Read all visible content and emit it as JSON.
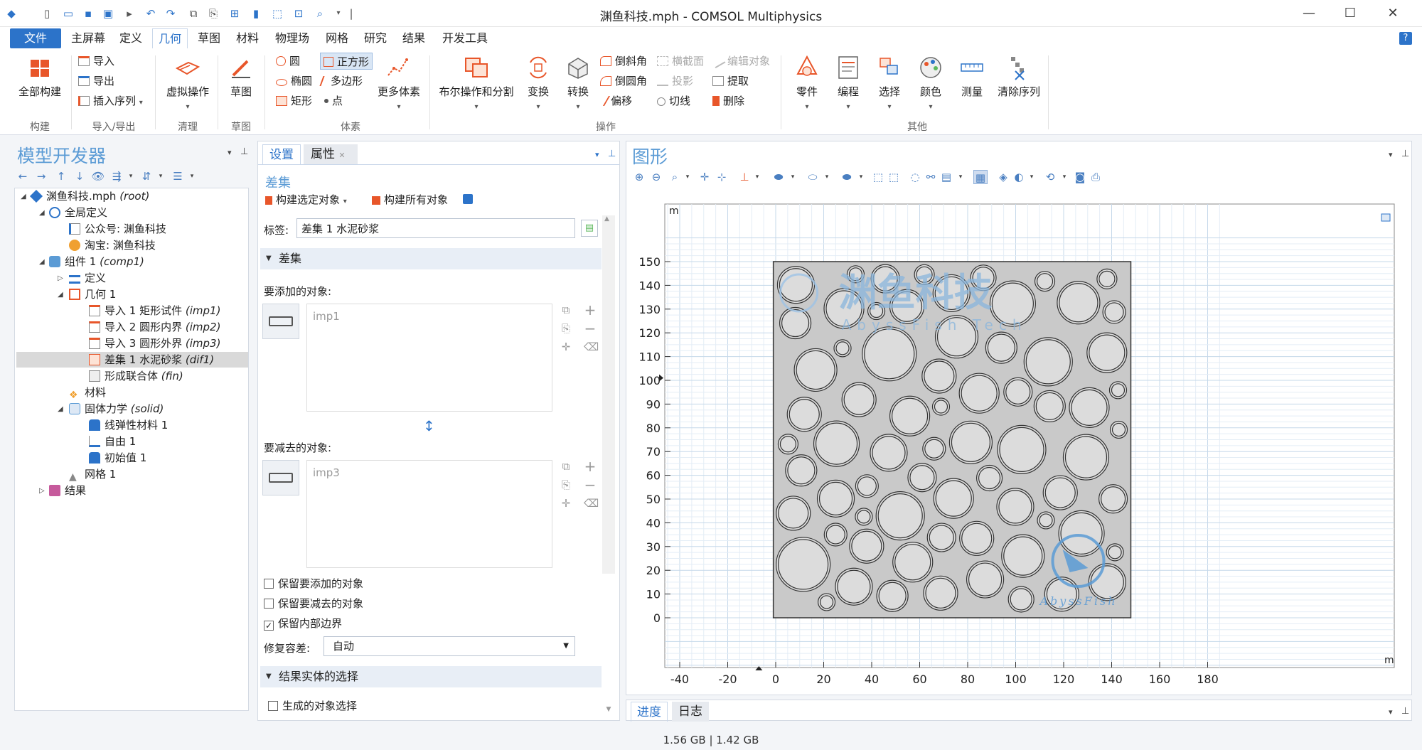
{
  "window": {
    "title": "渊鱼科技.mph - COMSOL Multiphysics",
    "minimize": "—",
    "maximize": "☐",
    "close": "✕"
  },
  "menu": {
    "file": "文件",
    "tabs": [
      "主屏幕",
      "定义",
      "几何",
      "草图",
      "材料",
      "物理场",
      "网格",
      "研究",
      "结果",
      "开发工具"
    ],
    "active_tab": "几何",
    "help": "?"
  },
  "ribbon": {
    "groups": {
      "build": "构建",
      "io": "导入/导出",
      "cleanup": "清理",
      "sketch": "草图",
      "primitives": "体素",
      "operations": "操作",
      "other": "其他"
    },
    "build_all": "全部构建",
    "import": "导入",
    "export": "导出",
    "insert_sequence": "插入序列",
    "virtual_ops": "虚拟操作",
    "sketch": "草图",
    "circle": "圆",
    "square": "正方形",
    "ellipse": "椭圆",
    "polygon": "多边形",
    "rectangle": "矩形",
    "point": "点",
    "more_primitives": "更多体素",
    "boolean_partition": "布尔操作和分割",
    "transforms": "变换",
    "conversions": "转换",
    "chamfer": "倒斜角",
    "fillet": "倒圆角",
    "offset": "偏移",
    "cross_section": "横截面",
    "projection": "投影",
    "tangent": "切线",
    "edit_object": "编辑对象",
    "extract": "提取",
    "delete": "删除",
    "parts": "零件",
    "programming": "编程",
    "selections": "选择",
    "colors": "颜色",
    "measure": "测量",
    "clear_sequence": "清除序列"
  },
  "model_builder": {
    "title": "模型开发器",
    "tree": [
      {
        "label": "渊鱼科技.mph",
        "tag": "(root)"
      },
      {
        "label": "全局定义",
        "tag": ""
      },
      {
        "label": "公众号: 渊鱼科技",
        "tag": ""
      },
      {
        "label": "淘宝: 渊鱼科技",
        "tag": ""
      },
      {
        "label": "组件 1",
        "tag": "(comp1)"
      },
      {
        "label": "定义",
        "tag": ""
      },
      {
        "label": "几何 1",
        "tag": ""
      },
      {
        "label": "导入 1 矩形试件",
        "tag": "(imp1)"
      },
      {
        "label": "导入 2 圆形内界",
        "tag": "(imp2)"
      },
      {
        "label": "导入 3 圆形外界",
        "tag": "(imp3)"
      },
      {
        "label": "差集 1 水泥砂浆",
        "tag": "(dif1)"
      },
      {
        "label": "形成联合体",
        "tag": "(fin)"
      },
      {
        "label": "材料",
        "tag": ""
      },
      {
        "label": "固体力学",
        "tag": "(solid)"
      },
      {
        "label": "线弹性材料 1",
        "tag": ""
      },
      {
        "label": "自由 1",
        "tag": ""
      },
      {
        "label": "初始值 1",
        "tag": ""
      },
      {
        "label": "网格 1",
        "tag": ""
      },
      {
        "label": "结果",
        "tag": ""
      }
    ]
  },
  "settings": {
    "tab_settings": "设置",
    "tab_properties": "属性",
    "node_title": "差集",
    "build_selected": "构建选定对象",
    "build_all": "构建所有对象",
    "label_caption": "标签:",
    "label_value": "差集 1 水泥砂浆",
    "section_difference": "差集",
    "objects_to_add": "要添加的对象:",
    "add_item": "imp1",
    "objects_to_subtract": "要减去的对象:",
    "subtract_item": "imp3",
    "keep_add": "保留要添加的对象",
    "keep_subtract": "保留要减去的对象",
    "keep_interior": "保留内部边界",
    "repair_tolerance": "修复容差:",
    "repair_value": "自动",
    "section_result": "结果实体的选择",
    "resulting_selection": "生成的对象选择"
  },
  "graphics": {
    "title": "图形",
    "unit": "m",
    "x_ticks": [
      "-40",
      "-20",
      "0",
      "20",
      "40",
      "60",
      "80",
      "100",
      "120",
      "140",
      "160",
      "180"
    ],
    "y_ticks": [
      "150",
      "140",
      "130",
      "120",
      "110",
      "100",
      "90",
      "80",
      "70",
      "60",
      "50",
      "40",
      "30",
      "20",
      "10",
      "0"
    ],
    "watermark_cn": "渊鱼科技",
    "watermark_en": "AbyssFish Tech",
    "watermark_small": "AbyssFish",
    "specimen_color": "#c9c9c9"
  },
  "bottom": {
    "progress": "进度",
    "log": "日志"
  },
  "status": {
    "memory": "1.56 GB | 1.42 GB"
  }
}
